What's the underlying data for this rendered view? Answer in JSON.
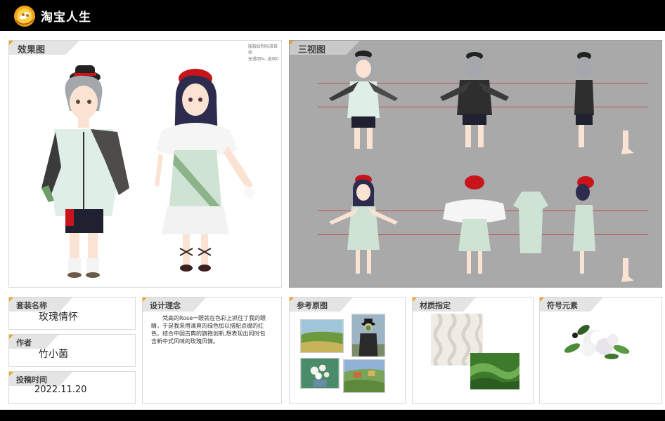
{
  "app": {
    "brand": "淘宝人生"
  },
  "sections": {
    "effect": {
      "title": "效果图",
      "note_line1": "服装绘制标准自检",
      "note_line2": "无透明%, 选项0"
    },
    "views": {
      "title": "三视图"
    },
    "suit_name": {
      "label": "套装名称",
      "value": "玫瑰情怀"
    },
    "author": {
      "label": "作者",
      "value": "竹小菌"
    },
    "date": {
      "label": "投稿时间",
      "value": "2022.11.20"
    },
    "concept": {
      "label": "设计理念",
      "text": "梵高的Rose一眼就在色彩上抓住了我的眼睛，于是我采用清爽的绿色加以搭配点缀的红色，结合中国古典的旗袍创新,想表现出同时包含新中式风味的玫瑰风情。"
    },
    "reference": {
      "label": "参考原图"
    },
    "material": {
      "label": "材质指定"
    },
    "symbol": {
      "label": "符号元素"
    }
  },
  "colors": {
    "topbar": "#000000",
    "accent": "#f2a316",
    "tab_gray": "#d6d6d6",
    "views_bg": "#a9a9a9",
    "mint": "#dfeee6",
    "green": "#6f9e6a",
    "red": "#c8151c",
    "hair_gray": "#a4a8ad",
    "hair_navy": "#2d2c4e",
    "skin": "#fbe3d3"
  },
  "icons": [
    "taobao-life-logo-icon"
  ]
}
